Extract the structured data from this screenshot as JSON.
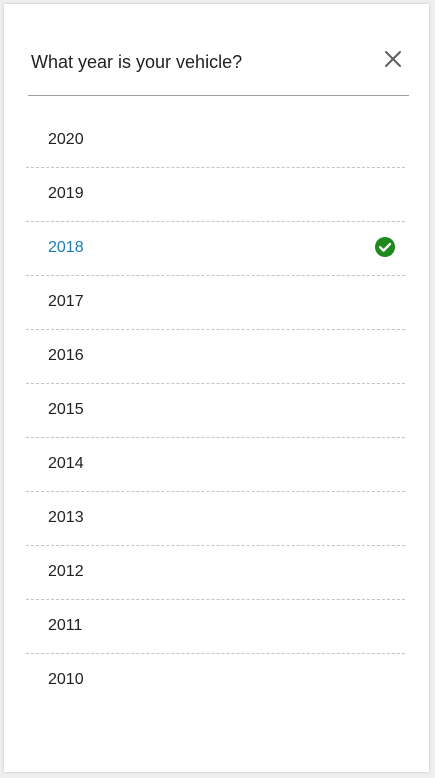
{
  "dialog": {
    "title": "What year is your vehicle?",
    "close_icon": "close-icon"
  },
  "years": [
    {
      "label": "2020",
      "selected": false
    },
    {
      "label": "2019",
      "selected": false
    },
    {
      "label": "2018",
      "selected": true
    },
    {
      "label": "2017",
      "selected": false
    },
    {
      "label": "2016",
      "selected": false
    },
    {
      "label": "2015",
      "selected": false
    },
    {
      "label": "2014",
      "selected": false
    },
    {
      "label": "2013",
      "selected": false
    },
    {
      "label": "2012",
      "selected": false
    },
    {
      "label": "2011",
      "selected": false
    },
    {
      "label": "2010",
      "selected": false
    }
  ],
  "colors": {
    "selected_text": "#1a7bb8",
    "check_green": "#1e8a1e"
  }
}
